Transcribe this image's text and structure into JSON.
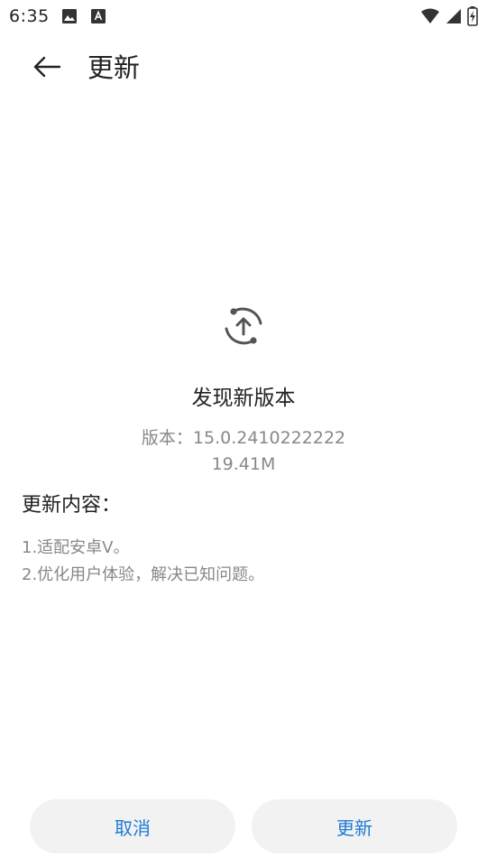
{
  "status_bar": {
    "time": "6:35",
    "left_icons": [
      "image-icon",
      "font-icon"
    ],
    "right_icons": [
      "wifi-icon",
      "cell-signal-icon",
      "battery-charging-icon"
    ]
  },
  "app_bar": {
    "title": "更新"
  },
  "update": {
    "headline": "发现新版本",
    "version_label": "版本：",
    "version_value": "15.0.2410222222",
    "size": "19.41M",
    "changelog_title": "更新内容：",
    "changelog_items": [
      "1.适配安卓V。",
      "2.优化用户体验，解决已知问题。"
    ]
  },
  "buttons": {
    "cancel_label": "取消",
    "update_label": "更新"
  },
  "colors": {
    "accent": "#1e7ad4",
    "secondary_text": "#888888",
    "button_bg": "#f2f2f2"
  }
}
